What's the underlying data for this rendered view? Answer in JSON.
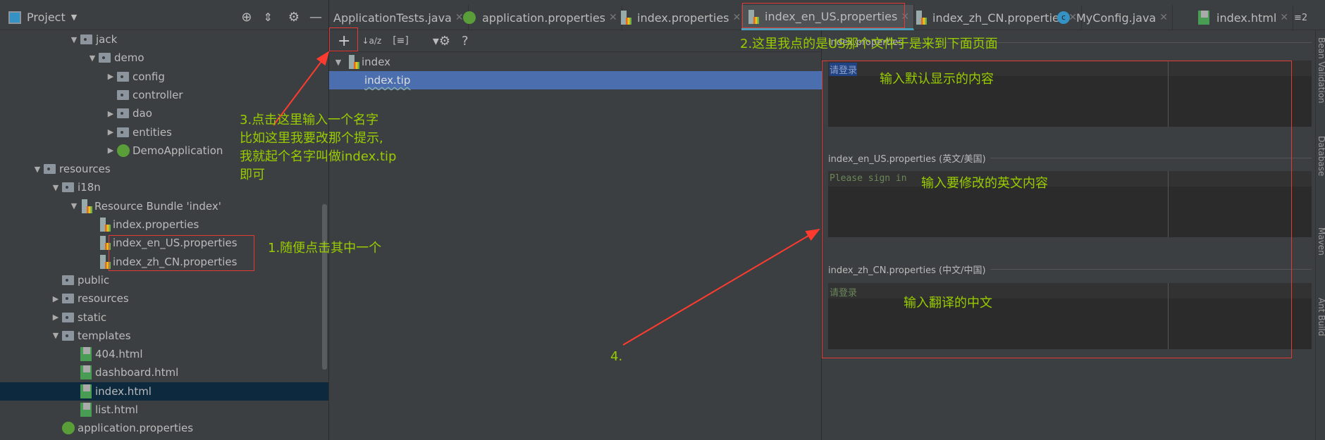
{
  "project_panel": {
    "title": "Project",
    "tree": [
      {
        "label": "jack",
        "icon": "folder-icon",
        "indent": 4,
        "arrow": "down"
      },
      {
        "label": "demo",
        "icon": "folder-icon",
        "indent": 5,
        "arrow": "down"
      },
      {
        "label": "config",
        "icon": "folder-icon",
        "indent": 6,
        "arrow": "right"
      },
      {
        "label": "controller",
        "icon": "folder-icon",
        "indent": 6,
        "arrow": ""
      },
      {
        "label": "dao",
        "icon": "folder-icon",
        "indent": 6,
        "arrow": "right"
      },
      {
        "label": "entities",
        "icon": "folder-icon",
        "indent": 6,
        "arrow": "right"
      },
      {
        "label": "DemoApplication",
        "icon": "spring-boot-class-icon",
        "indent": 6,
        "arrow": "right"
      },
      {
        "label": "resources",
        "icon": "resources-folder-icon",
        "indent": 2,
        "arrow": "down"
      },
      {
        "label": "i18n",
        "icon": "folder-icon",
        "indent": 3,
        "arrow": "down"
      },
      {
        "label": "Resource Bundle 'index'",
        "icon": "resource-bundle-icon",
        "indent": 4,
        "arrow": "down"
      },
      {
        "label": "index.properties",
        "icon": "properties-file-icon",
        "indent": 5,
        "arrow": ""
      },
      {
        "label": "index_en_US.properties",
        "icon": "properties-file-icon",
        "indent": 5,
        "arrow": ""
      },
      {
        "label": "index_zh_CN.properties",
        "icon": "properties-file-icon",
        "indent": 5,
        "arrow": ""
      },
      {
        "label": "public",
        "icon": "folder-icon",
        "indent": 3,
        "arrow": ""
      },
      {
        "label": "resources",
        "icon": "folder-icon",
        "indent": 3,
        "arrow": "right"
      },
      {
        "label": "static",
        "icon": "folder-icon",
        "indent": 3,
        "arrow": "right"
      },
      {
        "label": "templates",
        "icon": "folder-icon",
        "indent": 3,
        "arrow": "down"
      },
      {
        "label": "404.html",
        "icon": "html-file-icon",
        "indent": 4,
        "arrow": ""
      },
      {
        "label": "dashboard.html",
        "icon": "html-file-icon",
        "indent": 4,
        "arrow": ""
      },
      {
        "label": "index.html",
        "icon": "html-file-icon",
        "indent": 4,
        "arrow": "",
        "selected": true
      },
      {
        "label": "list.html",
        "icon": "html-file-icon",
        "indent": 4,
        "arrow": ""
      },
      {
        "label": "application.properties",
        "icon": "spring-properties-icon",
        "indent": 3,
        "arrow": ""
      }
    ]
  },
  "tabs": [
    {
      "label": "ApplicationTests.java",
      "icon": "none"
    },
    {
      "label": "application.properties",
      "icon": "spring-properties-icon"
    },
    {
      "label": "index.properties",
      "icon": "properties-file-icon"
    },
    {
      "label": "index_en_US.properties",
      "icon": "properties-file-icon",
      "active": true
    },
    {
      "label": "index_zh_CN.properties",
      "icon": "properties-file-icon"
    },
    {
      "label": "MyConfig.java",
      "icon": "java-class-icon"
    },
    {
      "label": "index.html",
      "icon": "html-file-icon"
    }
  ],
  "tabs_overflow": "≡2",
  "bundle_editor": {
    "toolbar": [
      "+",
      "↓a/z",
      "[≡]",
      "▾⚙",
      "?"
    ],
    "tree_root": "index",
    "selected_key": "index.tip",
    "sections": [
      {
        "header": "index.properties",
        "value": "请登录"
      },
      {
        "header": "index_en_US.properties (英文/美国)",
        "value": "Please sign in"
      },
      {
        "header": "index_zh_CN.properties (中文/中国)",
        "value": "请登录"
      }
    ]
  },
  "right_strip": [
    "Bean Validation",
    "Database",
    "Maven",
    "Ant Build"
  ],
  "annotations": {
    "step1": "1.随便点击其中一个",
    "step2": "2.这里我点的是US那个文件于是来到下面页面",
    "step3": [
      "3.点击这里输入一个名字",
      "比如这里我要改那个提示,",
      "我就起个名字叫做index.tip",
      "即可"
    ],
    "step4": "4.",
    "default_note": "输入默认显示的内容",
    "english_note": "输入要修改的英文内容",
    "chinese_note": "输入翻译的中文"
  },
  "colors": {
    "annotation": "#99cc00",
    "highlight_box": "#e53935",
    "selection": "#4b6eaf",
    "tree_selection": "#0d293e"
  }
}
